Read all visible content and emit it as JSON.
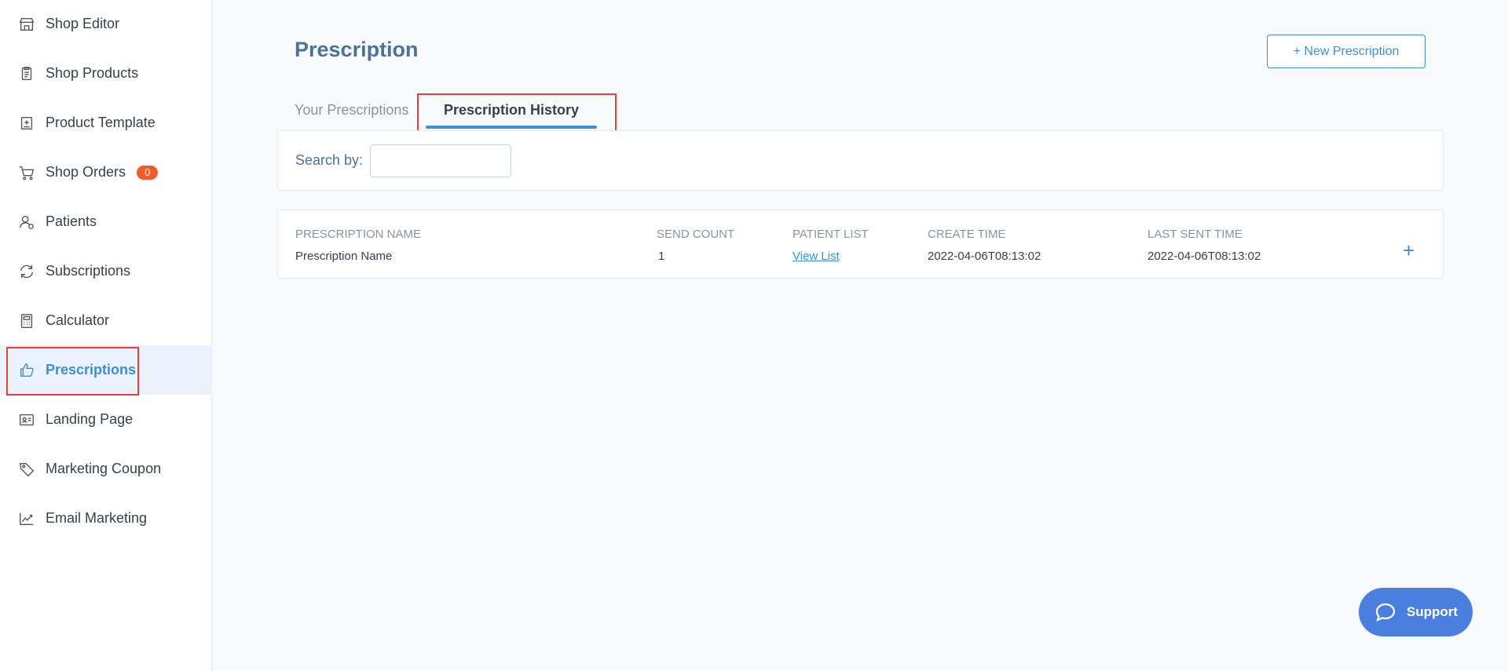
{
  "sidebar": {
    "items": [
      {
        "label": "Shop Editor",
        "icon": "shop-icon"
      },
      {
        "label": "Shop Products",
        "icon": "clipboard-icon"
      },
      {
        "label": "Product Template",
        "icon": "template-icon"
      },
      {
        "label": "Shop Orders",
        "icon": "cart-icon",
        "badge": "0"
      },
      {
        "label": "Patients",
        "icon": "patients-icon"
      },
      {
        "label": "Subscriptions",
        "icon": "refresh-icon"
      },
      {
        "label": "Calculator",
        "icon": "calculator-icon"
      },
      {
        "label": "Prescriptions",
        "icon": "thumbs-up-icon",
        "active": true
      },
      {
        "label": "Landing Page",
        "icon": "id-card-icon"
      },
      {
        "label": "Marketing Coupon",
        "icon": "tag-icon"
      },
      {
        "label": "Email Marketing",
        "icon": "chart-line-icon"
      }
    ]
  },
  "main": {
    "title": "Prescription",
    "new_button": "+ New Prescription",
    "tabs": [
      {
        "label": "Your Prescriptions",
        "active": false
      },
      {
        "label": "Prescription History",
        "active": true
      }
    ],
    "search": {
      "label": "Search by:",
      "value": "",
      "placeholder": ""
    },
    "table": {
      "headers": [
        "PRESCRIPTION NAME",
        "SEND COUNT",
        "PATIENT LIST",
        "CREATE TIME",
        "LAST SENT TIME"
      ],
      "rows": [
        {
          "name": "Prescription Name",
          "send_count": "1",
          "patient_list": "View List",
          "create_time": "2022-04-06T08:13:02",
          "last_sent_time": "2022-04-06T08:13:02"
        }
      ],
      "expand_icon": "plus-icon"
    }
  },
  "support": {
    "label": "Support",
    "icon": "chat-bubble-icon"
  },
  "colors": {
    "accent": "#3a8fd6",
    "title": "#4a7396",
    "badge": "#ef5a2a",
    "highlight": "#e53e3e",
    "support": "#4a7fe0"
  }
}
